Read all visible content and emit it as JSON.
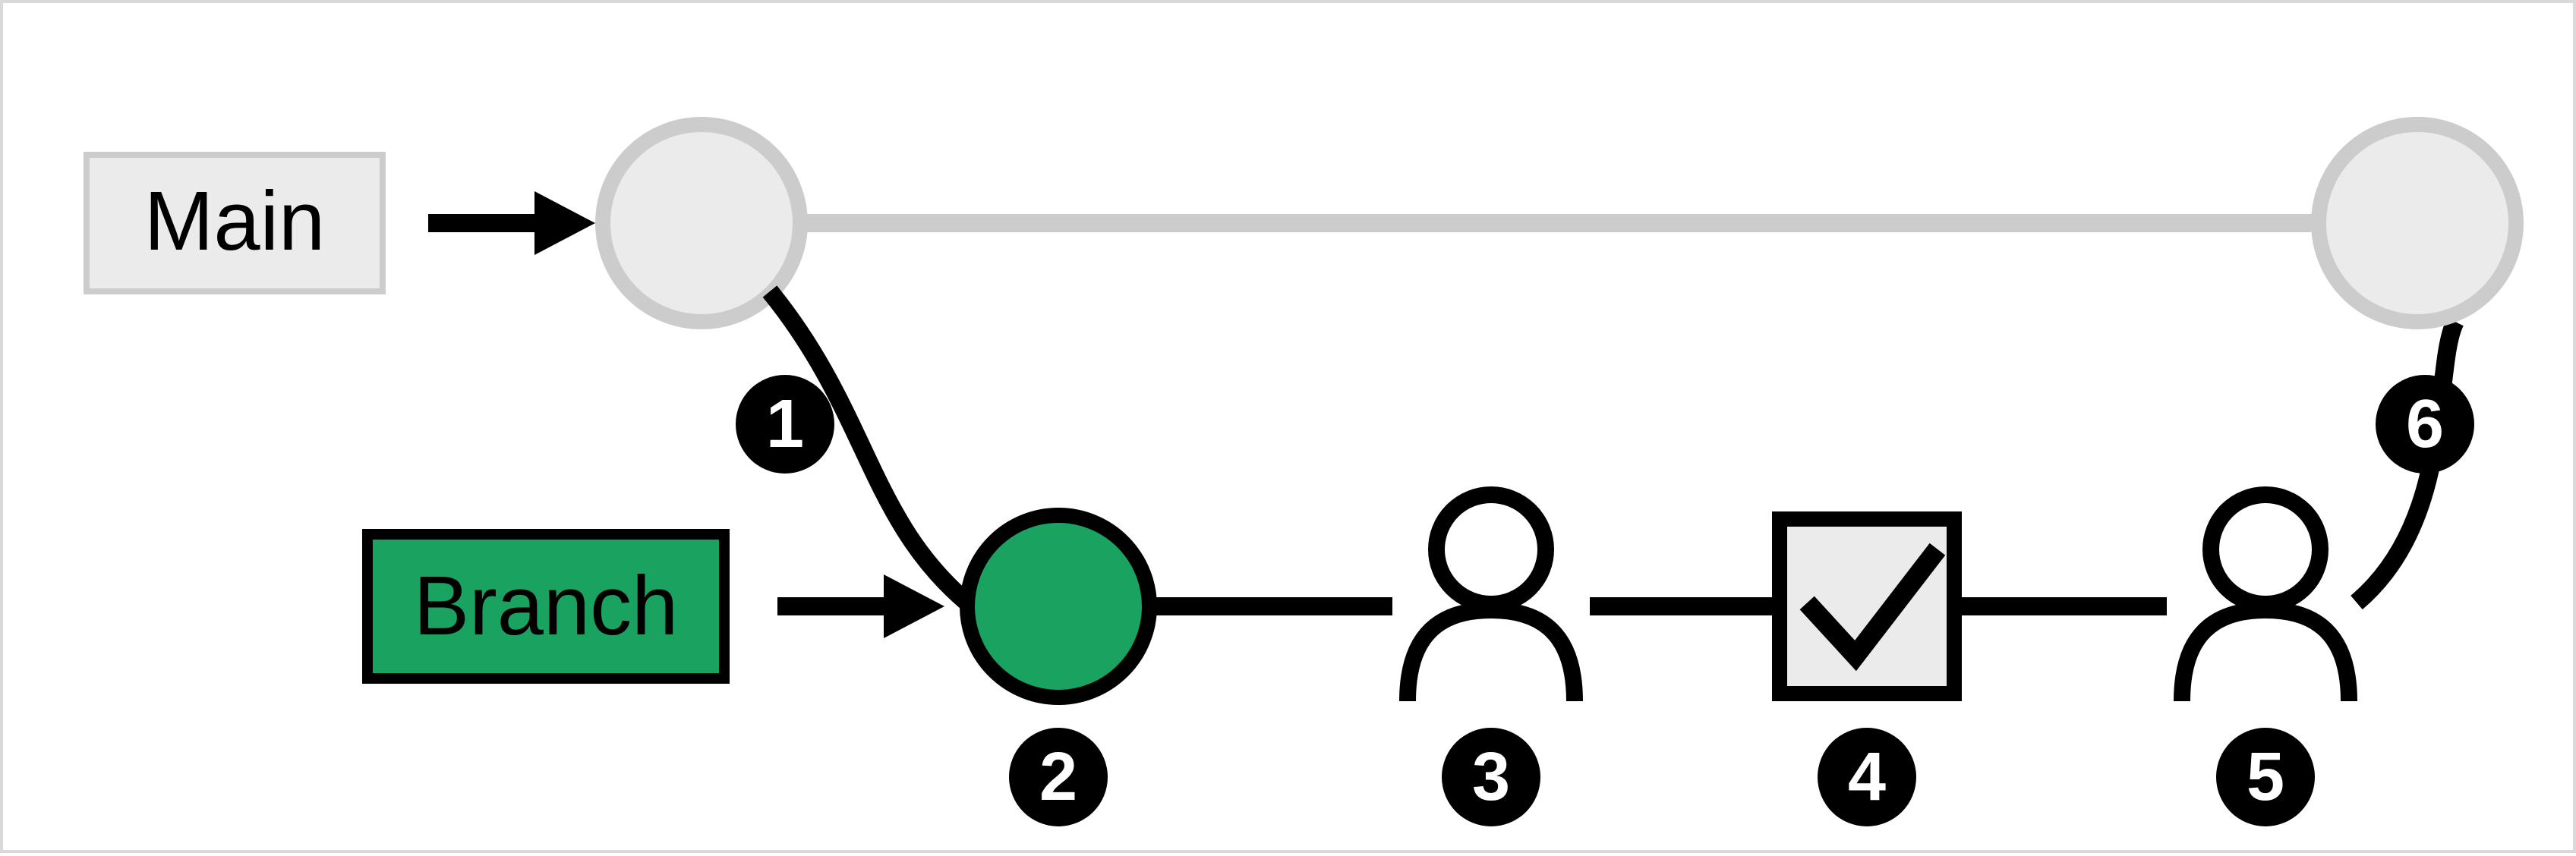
{
  "labels": {
    "main": "Main",
    "branch": "Branch"
  },
  "steps": {
    "s1": "1",
    "s2": "2",
    "s3": "3",
    "s4": "4",
    "s5": "5",
    "s6": "6"
  },
  "colors": {
    "green": "#1aa260",
    "lightgray": "#ebebeb",
    "gray_stroke": "#cccccc",
    "black": "#000000"
  }
}
